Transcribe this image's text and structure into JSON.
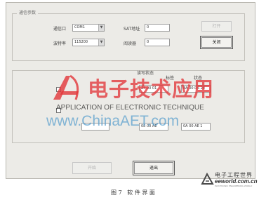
{
  "serial_group": {
    "title": "通信参数",
    "port_label": "通信口",
    "port_value": "COM1",
    "baud_label": "波特率",
    "baud_value": "115200",
    "sat_addr_label": "SAT地址",
    "sat_addr_value": "0",
    "read_addr_label": "阅读器",
    "read_addr_value": "0",
    "open_button": "打开",
    "close_button": "关闭"
  },
  "status_group": {
    "title": "读写状态",
    "tag_header": "标签",
    "status_header": "状态",
    "rows": [
      {
        "value": "24 00 01",
        "status": "8A 00 D5 2E"
      },
      {
        "value": "",
        "status": ""
      },
      {
        "value": "08 00 AE",
        "status": "0A 00 AE 1"
      }
    ]
  },
  "footer": {
    "start_button": "开始",
    "exit_button": "退出"
  },
  "watermark": {
    "chinese": "电子技术应用",
    "english": "APPLICATION OF ELECTRONIC TECHNIQUE",
    "url": "www.ChinaAET.com"
  },
  "brand": {
    "name": "电子工程世界",
    "url": "eeworld.com.cn",
    "tagline": "ELECTRONIC ENGINEERING WORLD"
  },
  "caption": "图 7   软 件 界 面",
  "colors": {
    "dialog_bg": "#ecebe7",
    "watermark_red": "#e2363a",
    "watermark_blue": "#5ca0cd"
  }
}
